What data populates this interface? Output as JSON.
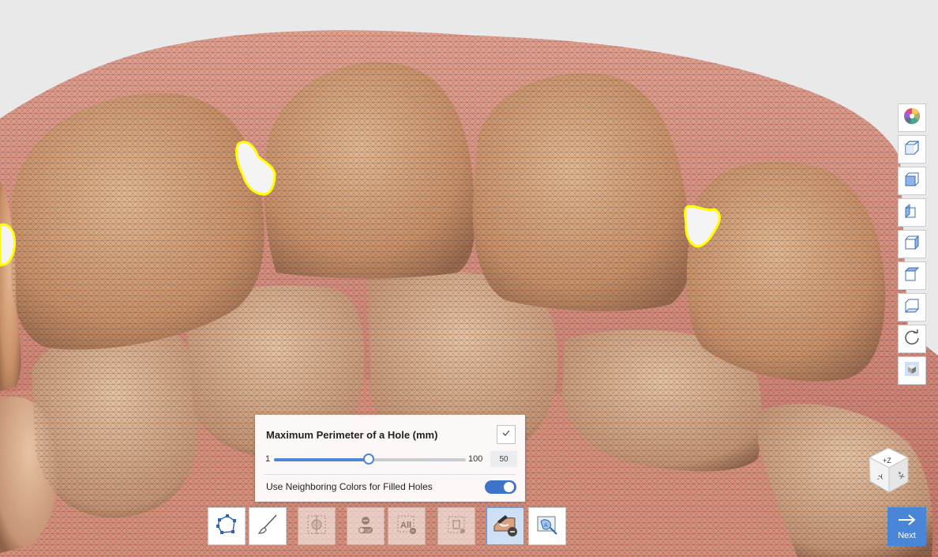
{
  "panel": {
    "title": "Maximum Perimeter of a Hole (mm)",
    "slider_min": "1",
    "slider_max": "100",
    "slider_value": "50",
    "slider_level_fraction": 0.495,
    "toggle_label": "Use Neighboring Colors for Filled Holes",
    "toggle_on": true
  },
  "toolbar": {
    "items": [
      {
        "name": "polyline-select-tool",
        "icon": "polygon-lasso-icon",
        "state": "enabled"
      },
      {
        "name": "brush-select-tool",
        "icon": "brush-icon",
        "state": "enabled"
      },
      {
        "name": "invert-selection-tool",
        "icon": "invert-selection-icon",
        "state": "disabled"
      },
      {
        "name": "deselect-tool",
        "icon": "deselect-off-icon",
        "state": "disabled",
        "label": "Off"
      },
      {
        "name": "select-all-tool",
        "icon": "select-all-icon",
        "state": "disabled",
        "label": "All"
      },
      {
        "name": "delete-selection-tool",
        "icon": "trash-icon",
        "state": "disabled"
      },
      {
        "name": "remove-fill-tool",
        "icon": "eraser-fill-icon",
        "state": "active"
      },
      {
        "name": "auto-fill-tool",
        "icon": "auto-fill-icon",
        "state": "enabled"
      }
    ]
  },
  "view_controls": {
    "items": [
      {
        "name": "color-toggle",
        "icon": "color-wheel-icon"
      },
      {
        "name": "view-iso",
        "icon": "cube-iso-icon"
      },
      {
        "name": "view-front",
        "icon": "cube-front-icon"
      },
      {
        "name": "view-left",
        "icon": "cube-left-icon"
      },
      {
        "name": "view-right",
        "icon": "cube-right-icon"
      },
      {
        "name": "view-top",
        "icon": "cube-top-icon"
      },
      {
        "name": "view-bottom",
        "icon": "cube-bottom-icon"
      },
      {
        "name": "view-reset",
        "icon": "rotate-icon"
      },
      {
        "name": "view-solid",
        "icon": "solid-cube-icon"
      }
    ]
  },
  "orientation_cube": {
    "labels": [
      "+Z",
      "-Y",
      "+X"
    ]
  },
  "next_button": {
    "label": "Next"
  },
  "colors": {
    "accent": "#4a86d8",
    "hole_outline": "#ffff00",
    "gum": "#d98d7a",
    "tooth": "#d6a680"
  }
}
